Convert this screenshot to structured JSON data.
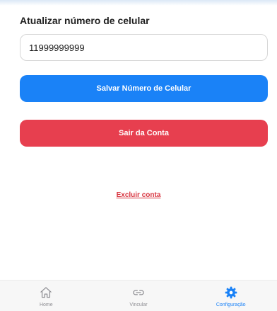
{
  "phone_section": {
    "title": "Atualizar número de celular",
    "phone_value": "11999999999"
  },
  "actions": {
    "save_label": "Salvar Número de Celular",
    "logout_label": "Sair da Conta",
    "delete_label": "Excluir conta"
  },
  "colors": {
    "primary": "#1a82f7",
    "danger": "#e73f4f",
    "inactive_tab": "#8e8e93"
  },
  "tabbar": {
    "tabs": [
      {
        "label": "Home",
        "icon": "home-icon",
        "active": false
      },
      {
        "label": "Vincular",
        "icon": "link-icon",
        "active": false
      },
      {
        "label": "Configuração",
        "icon": "gear-icon",
        "active": true
      }
    ]
  }
}
